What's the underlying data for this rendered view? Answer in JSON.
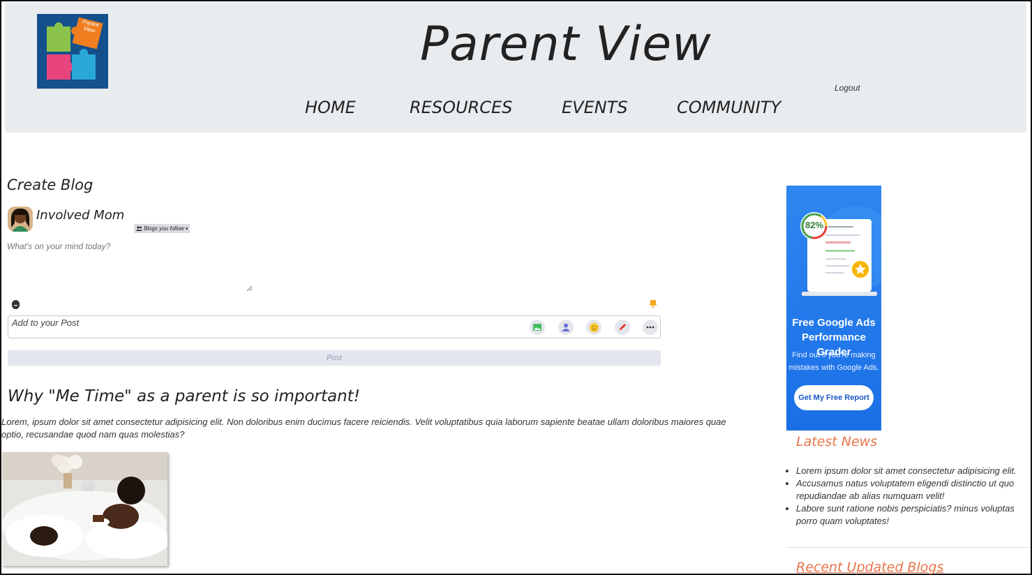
{
  "header": {
    "logo_text": "Parent View",
    "site_title": "Parent View",
    "nav": [
      "HOME",
      "RESOURCES",
      "EVENTS",
      "COMMUNITY"
    ],
    "logout": "Logout"
  },
  "create_blog": {
    "title": "Create Blog",
    "user_name": "Involved Mom",
    "follow_label": "Blogs you follow",
    "textarea_placeholder": "What's on your mind today?",
    "add_to_post": "Add to your Post",
    "post_button": "Post",
    "tool_icons": [
      "photo-icon",
      "tag-people-icon",
      "emoji-icon",
      "pen-icon",
      "more-icon"
    ]
  },
  "blog": {
    "title": "Why \"Me Time\" as a parent is so important!",
    "body": "Lorem, ipsum dolor sit amet consectetur adipisicing elit. Non doloribus enim ducimus facere reiciendis. Velit voluptatibus quia laborum sapiente beatae ullam doloribus maiores quae optio, recusandae quod nam quas molestias?"
  },
  "ad": {
    "percent": "82%",
    "title_line1": "Free Google Ads",
    "title_line2": "Performance Grader",
    "sub_line1": "Find out if you're making",
    "sub_line2": "mistakes with Google Ads.",
    "button": "Get My Free Report"
  },
  "sidebar": {
    "latest_news_title": "Latest News",
    "news": [
      "Lorem ipsum dolor sit amet consectetur adipisicing elit.",
      "Accusamus natus voluptatem eligendi distinctio ut quo repudiandae ab alias numquam velit!",
      "Labore sunt ratione nobis perspiciatis? minus voluptas porro quam voluptates!"
    ],
    "recent_blogs_title": "Recent Updated Blogs"
  },
  "colors": {
    "header_bg": "#e9ecef",
    "accent_orange": "#e8744a",
    "ad_blue": "#1a6fe6"
  }
}
